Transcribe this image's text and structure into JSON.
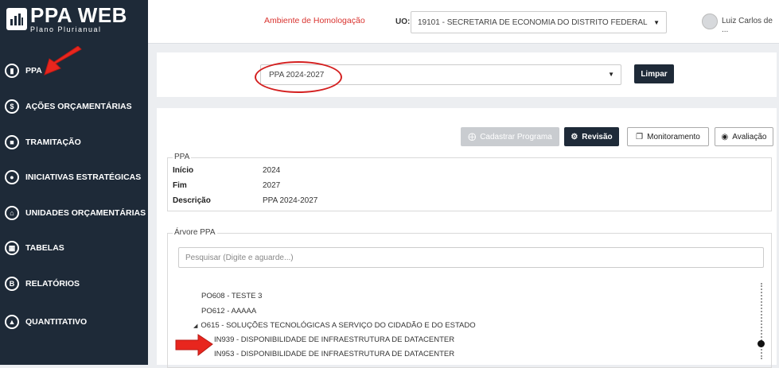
{
  "app": {
    "logo_title": "PPA WEB",
    "logo_subtitle": "Plano Plurianual"
  },
  "sidebar": {
    "items": [
      {
        "label": "PPA",
        "icon": "book-icon"
      },
      {
        "label": "AÇÕES ORÇAMENTÁRIAS",
        "icon": "dollar-icon"
      },
      {
        "label": "TRAMITAÇÃO",
        "icon": "lock-icon"
      },
      {
        "label": "INICIATIVAS ESTRATÉGICAS",
        "icon": "accessibility-icon"
      },
      {
        "label": "UNIDADES ORÇAMENTÁRIAS",
        "icon": "bank-icon"
      },
      {
        "label": "TABELAS",
        "icon": "table-icon"
      },
      {
        "label": "RELATÓRIOS",
        "icon": "document-icon"
      },
      {
        "label": "QUANTITATIVO",
        "icon": "chart-icon"
      }
    ]
  },
  "header": {
    "environment": "Ambiente de Homologação",
    "uo_label": "UO:",
    "uo_value": "19101 - SECRETARIA DE ECONOMIA DO DISTRITO FEDERAL",
    "user_name": "Luiz Carlos de ..."
  },
  "filter": {
    "ppa_value": "PPA 2024-2027",
    "clear_label": "Limpar"
  },
  "actions": {
    "cadastrar": "Cadastrar Programa",
    "revisao": "Revisão",
    "monitoramento": "Monitoramento",
    "avaliacao": "Avaliação"
  },
  "ppa_info": {
    "legend": "PPA",
    "inicio_label": "Início",
    "inicio_value": "2024",
    "fim_label": "Fim",
    "fim_value": "2027",
    "descricao_label": "Descrição",
    "descricao_value": "PPA 2024-2027"
  },
  "tree": {
    "legend": "Árvore PPA",
    "search_placeholder": "Pesquisar (Digite e aguarde...)",
    "items": [
      "PO608 - TESTE 3",
      "PO612 - AAAAA",
      "O615 - SOLUÇÕES TECNOLÓGICAS A SERVIÇO DO CIDADÃO E DO ESTADO",
      "IN939 - DISPONIBILIDADE DE INFRAESTRUTURA DE DATACENTER",
      "IN953 - DISPONIBILIDADE DE INFRAESTRUTURA DE DATACENTER"
    ]
  },
  "colors": {
    "sidebar_bg": "#1e2a38",
    "accent_red": "#d9332f",
    "primary_button": "#1e2a38"
  }
}
